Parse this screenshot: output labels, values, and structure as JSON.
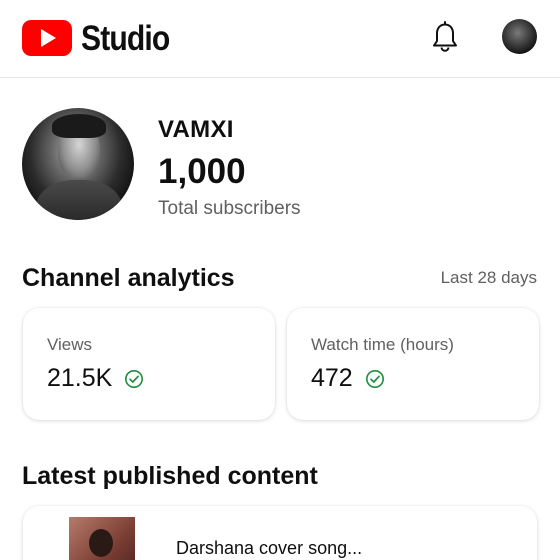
{
  "header": {
    "logo_text": "Studio",
    "logo_icon": "youtube-play-icon",
    "notifications_icon": "bell-icon",
    "account_icon": "avatar",
    "brand_color": "#ff0000"
  },
  "channel": {
    "name": "VAMXI",
    "subscribers": "1,000",
    "subscribers_label": "Total subscribers"
  },
  "analytics": {
    "title": "Channel analytics",
    "range": "Last 28 days",
    "cards": [
      {
        "label": "Views",
        "value": "21.5K",
        "status_icon": "check-circle-icon"
      },
      {
        "label": "Watch time (hours)",
        "value": "472",
        "status_icon": "check-circle-icon"
      }
    ],
    "status_color": "#1e8e3e"
  },
  "latest": {
    "title": "Latest published content",
    "video_title": "Darshana cover song..."
  }
}
